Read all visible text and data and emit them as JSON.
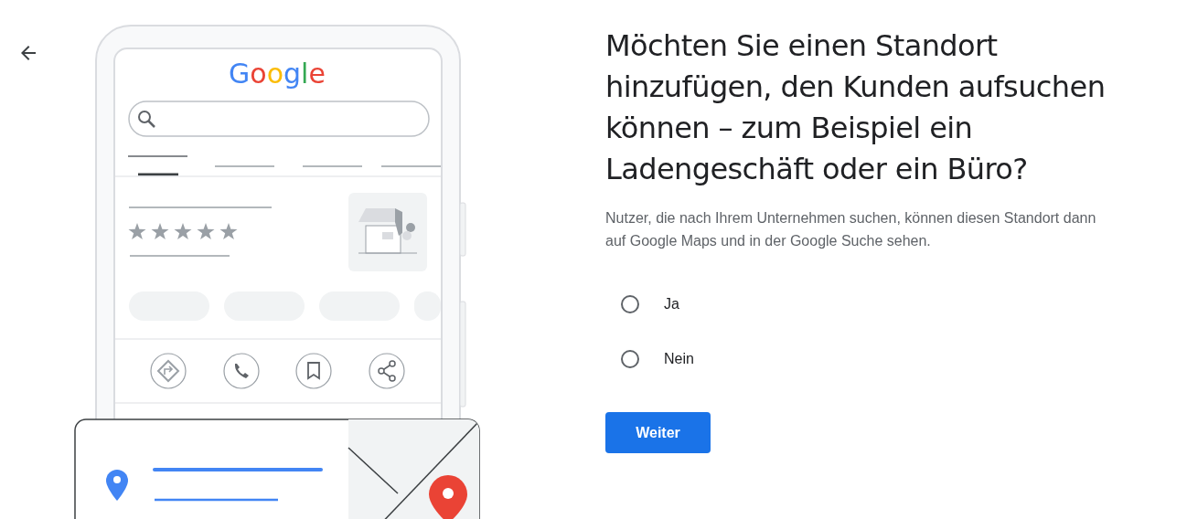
{
  "illustration": {
    "logo": "Google"
  },
  "heading": "Möchten Sie einen Standort hinzufügen, den Kunden aufsuchen können – zum Beispiel ein Ladengeschäft oder ein Büro?",
  "description": "Nutzer, die nach Ihrem Unternehmen suchen, können diesen Standort dann auf Google Maps und in der Google Suche sehen.",
  "options": [
    {
      "label": "Ja",
      "selected": false
    },
    {
      "label": "Nein",
      "selected": false
    }
  ],
  "button": "Weiter"
}
